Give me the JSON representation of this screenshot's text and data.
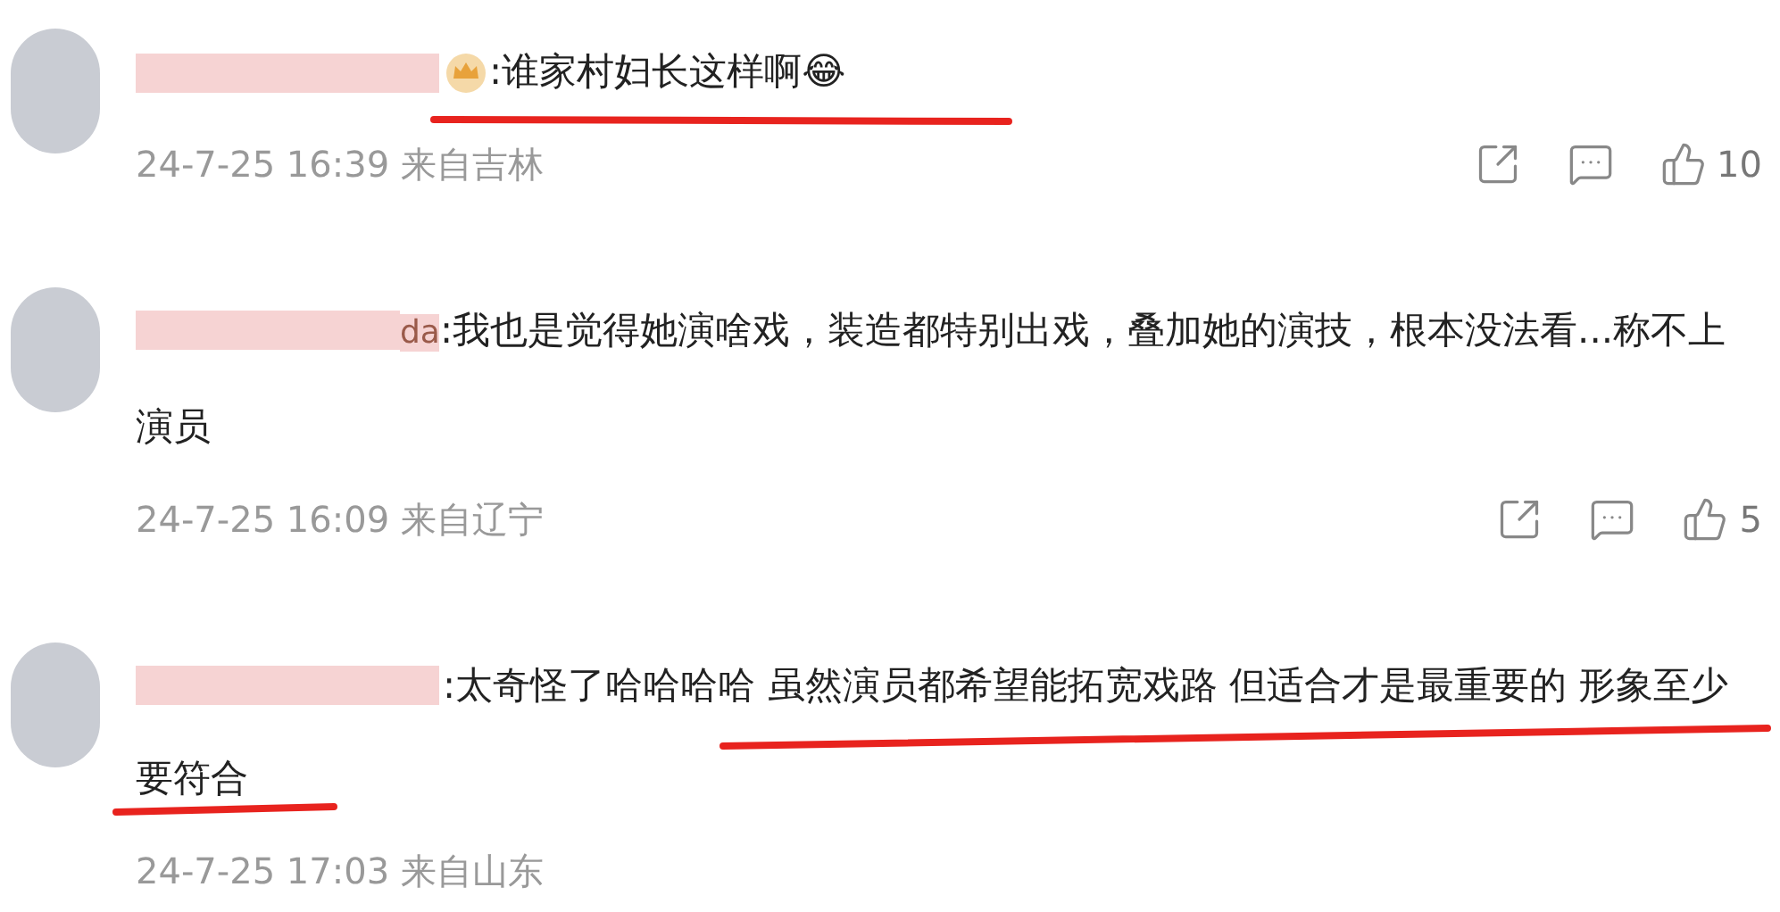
{
  "comments": [
    {
      "badge": true,
      "text": ":谁家村妇长这样啊",
      "emoji": "😂",
      "time": "24-7-25 16:39 来自吉林",
      "likes": "10"
    },
    {
      "username_fragment": "da",
      "text": ":我也是觉得她演啥戏，装造都特别出戏，叠加她的演技，根本没法看...称不上演员",
      "time": "24-7-25 16:09 来自辽宁",
      "likes": "5"
    },
    {
      "text": ":太奇怪了哈哈哈哈 虽然演员都希望能拓宽戏路 但适合才是最重要的 形象至少要符合",
      "time": "24-7-25 17:03 来自山东"
    }
  ]
}
